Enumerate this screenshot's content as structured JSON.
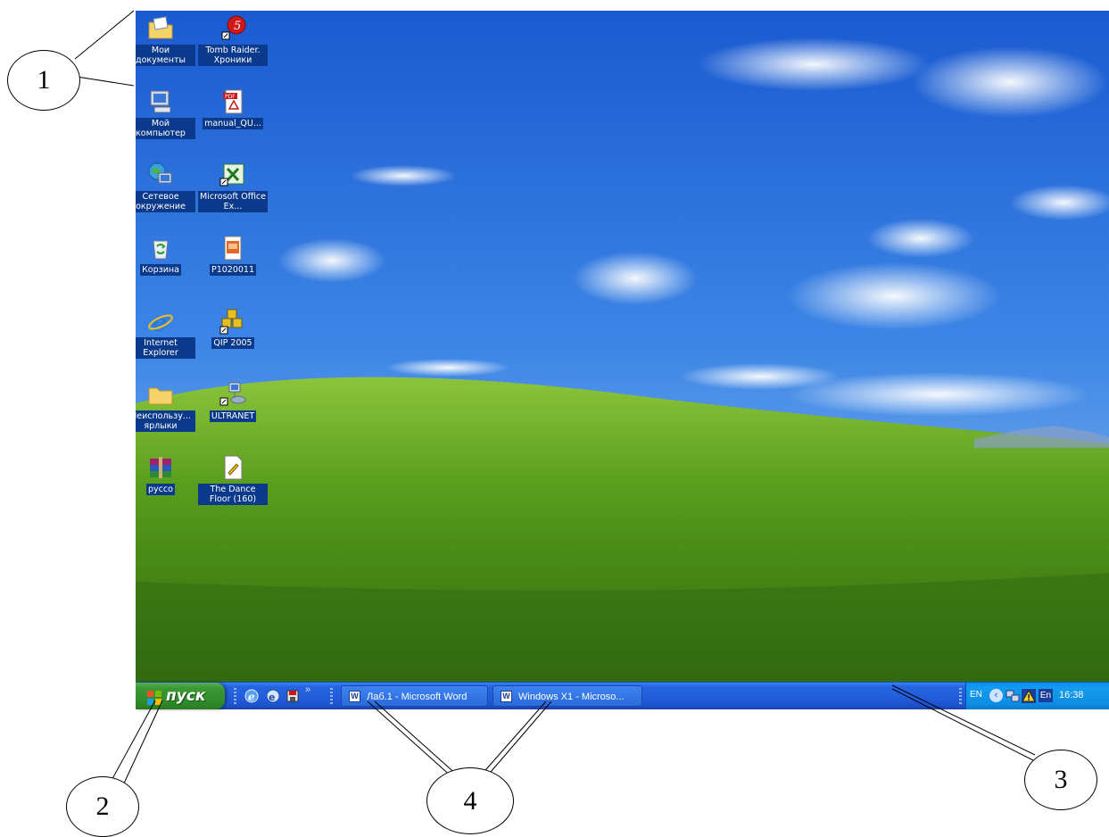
{
  "desktop": {
    "icons": [
      {
        "label": "Мои документы",
        "icon": "folder-documents-icon"
      },
      {
        "label": "Tomb Raider. Хроники",
        "icon": "game-shortcut-icon"
      },
      {
        "label": "Мой компьютер",
        "icon": "computer-icon"
      },
      {
        "label": "manual_QU...",
        "icon": "pdf-file-icon"
      },
      {
        "label": "Сетевое окружение",
        "icon": "network-places-icon"
      },
      {
        "label": "Microsoft Office Ex...",
        "icon": "excel-shortcut-icon"
      },
      {
        "label": "Корзина",
        "icon": "recycle-bin-icon"
      },
      {
        "label": "P1020011",
        "icon": "image-file-icon"
      },
      {
        "label": "Internet Explorer",
        "icon": "internet-explorer-icon"
      },
      {
        "label": "QIP 2005",
        "icon": "qip-shortcut-icon"
      },
      {
        "label": "Неиспользу... ярлыки",
        "icon": "folder-icon"
      },
      {
        "label": "ULTRANET",
        "icon": "network-shortcut-icon"
      },
      {
        "label": "руссо",
        "icon": "archive-icon"
      },
      {
        "label": "The Dance Floor (160)",
        "icon": "media-file-icon"
      }
    ]
  },
  "taskbar": {
    "start_label": "пуск",
    "quick_launch": [
      "ie-icon",
      "browser-icon",
      "save-icon"
    ],
    "tasks": [
      {
        "label": "Лаб.1 - Microsoft Word",
        "icon": "word-icon"
      },
      {
        "label": "Windows X1 - Microso...",
        "icon": "word-icon"
      }
    ],
    "tray": {
      "lang": "EN",
      "lang2": "En",
      "clock": "16:38"
    }
  },
  "annotations": [
    "1",
    "2",
    "3",
    "4"
  ],
  "colors": {
    "taskbar": "#245edb",
    "start_button": "#3c9a34",
    "tray": "#0f8df0",
    "icon_label_bg": "#0b3a8c"
  }
}
